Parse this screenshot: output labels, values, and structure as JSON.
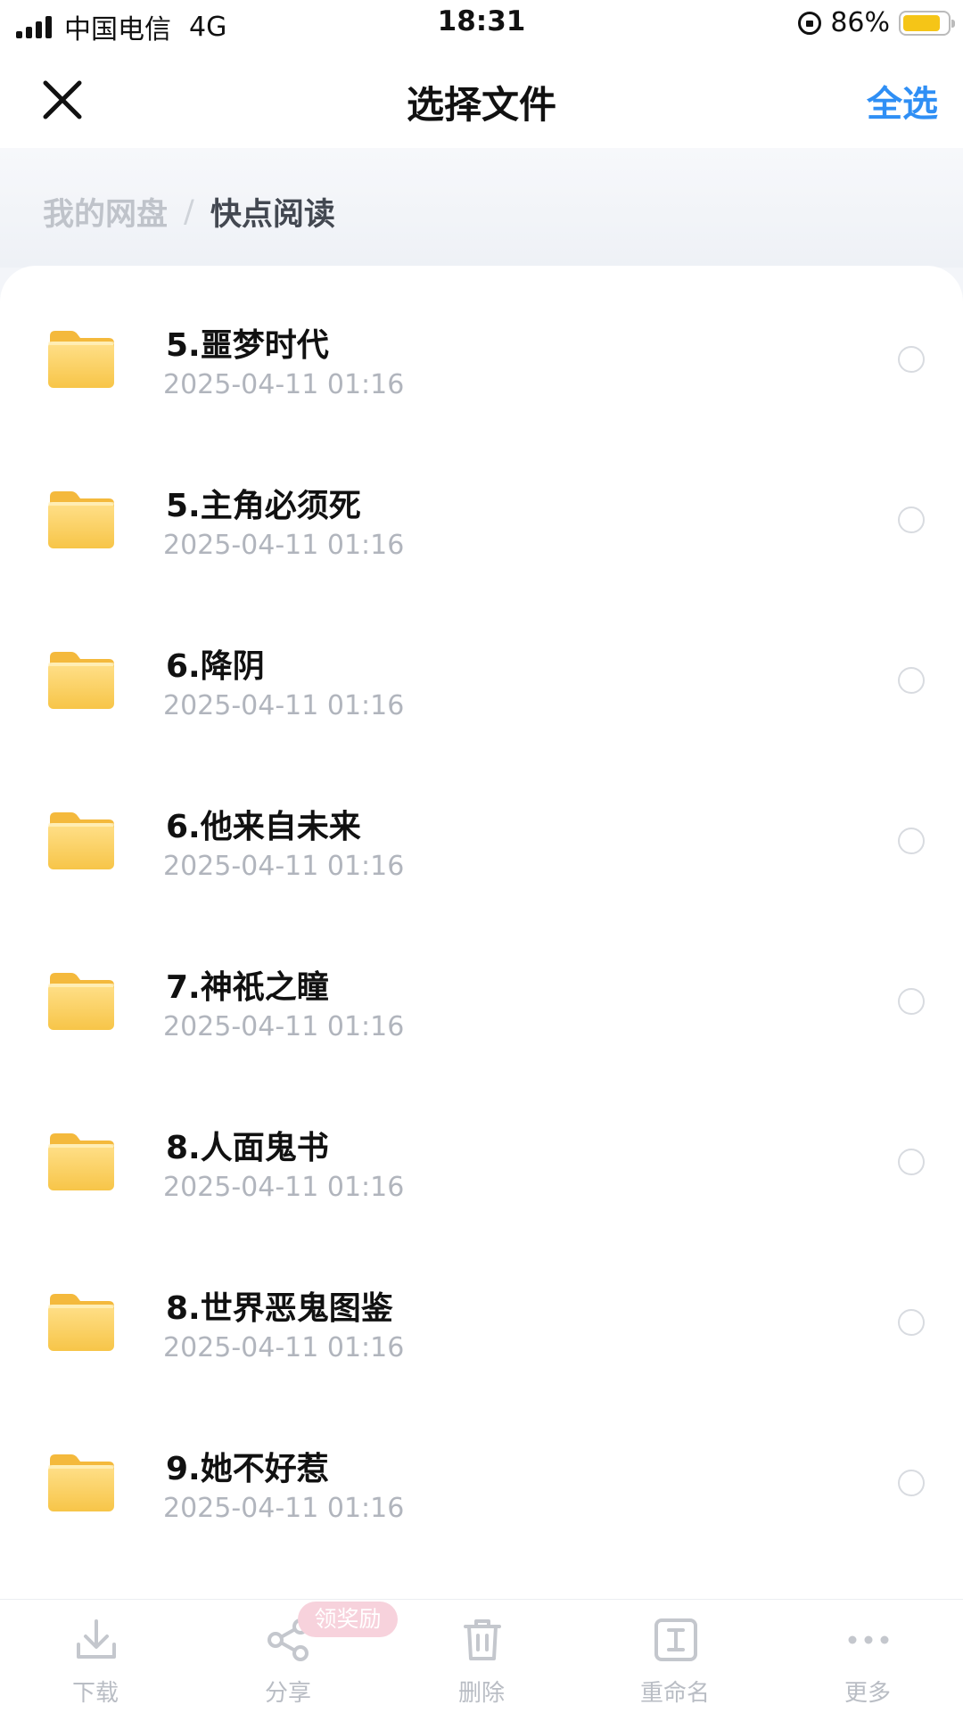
{
  "status_bar": {
    "carrier": "中国电信",
    "network": "4G",
    "time": "18:31",
    "battery": "86%",
    "battery_level": 0.86
  },
  "header": {
    "title": "选择文件",
    "select_all": "全选"
  },
  "breadcrumb": {
    "root": "我的网盘",
    "separator": "/",
    "current": "快点阅读"
  },
  "files": [
    {
      "name": "5.噩梦时代",
      "time": "2025-04-11 01:16"
    },
    {
      "name": "5.主角必须死",
      "time": "2025-04-11 01:16"
    },
    {
      "name": "6.降阴",
      "time": "2025-04-11 01:16"
    },
    {
      "name": "6.他来自未来",
      "time": "2025-04-11 01:16"
    },
    {
      "name": "7.神祇之瞳",
      "time": "2025-04-11 01:16"
    },
    {
      "name": "8.人面鬼书",
      "time": "2025-04-11 01:16"
    },
    {
      "name": "8.世界恶鬼图鉴",
      "time": "2025-04-11 01:16"
    },
    {
      "name": "9.她不好惹",
      "time": "2025-04-11 01:16"
    }
  ],
  "toolbar": {
    "download": "下载",
    "share": "分享",
    "reward_badge": "领奖励",
    "delete": "删除",
    "rename": "重命名",
    "more": "更多"
  }
}
